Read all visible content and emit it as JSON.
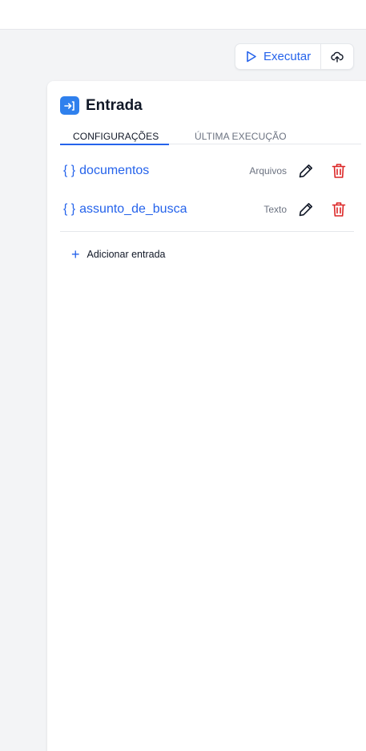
{
  "toolbar": {
    "run_label": "Executar",
    "run_icon": "play-icon",
    "upload_icon": "cloud-upload-icon"
  },
  "panel": {
    "title": "Entrada",
    "title_icon": "enter-icon"
  },
  "tabs": [
    {
      "label": "CONFIGURAÇÕES",
      "active": true
    },
    {
      "label": "ÚLTIMA EXECUÇÃO",
      "active": false
    }
  ],
  "inputs": [
    {
      "brace": "{ }",
      "name": "documentos",
      "type": "Arquivos"
    },
    {
      "brace": "{ }",
      "name": "assunto_de_busca",
      "type": "Texto"
    }
  ],
  "add_entry": {
    "plus": "+",
    "label": "Adicionar entrada"
  },
  "colors": {
    "accent": "#2563eb",
    "danger": "#dc2626",
    "background": "#f3f4f6"
  }
}
